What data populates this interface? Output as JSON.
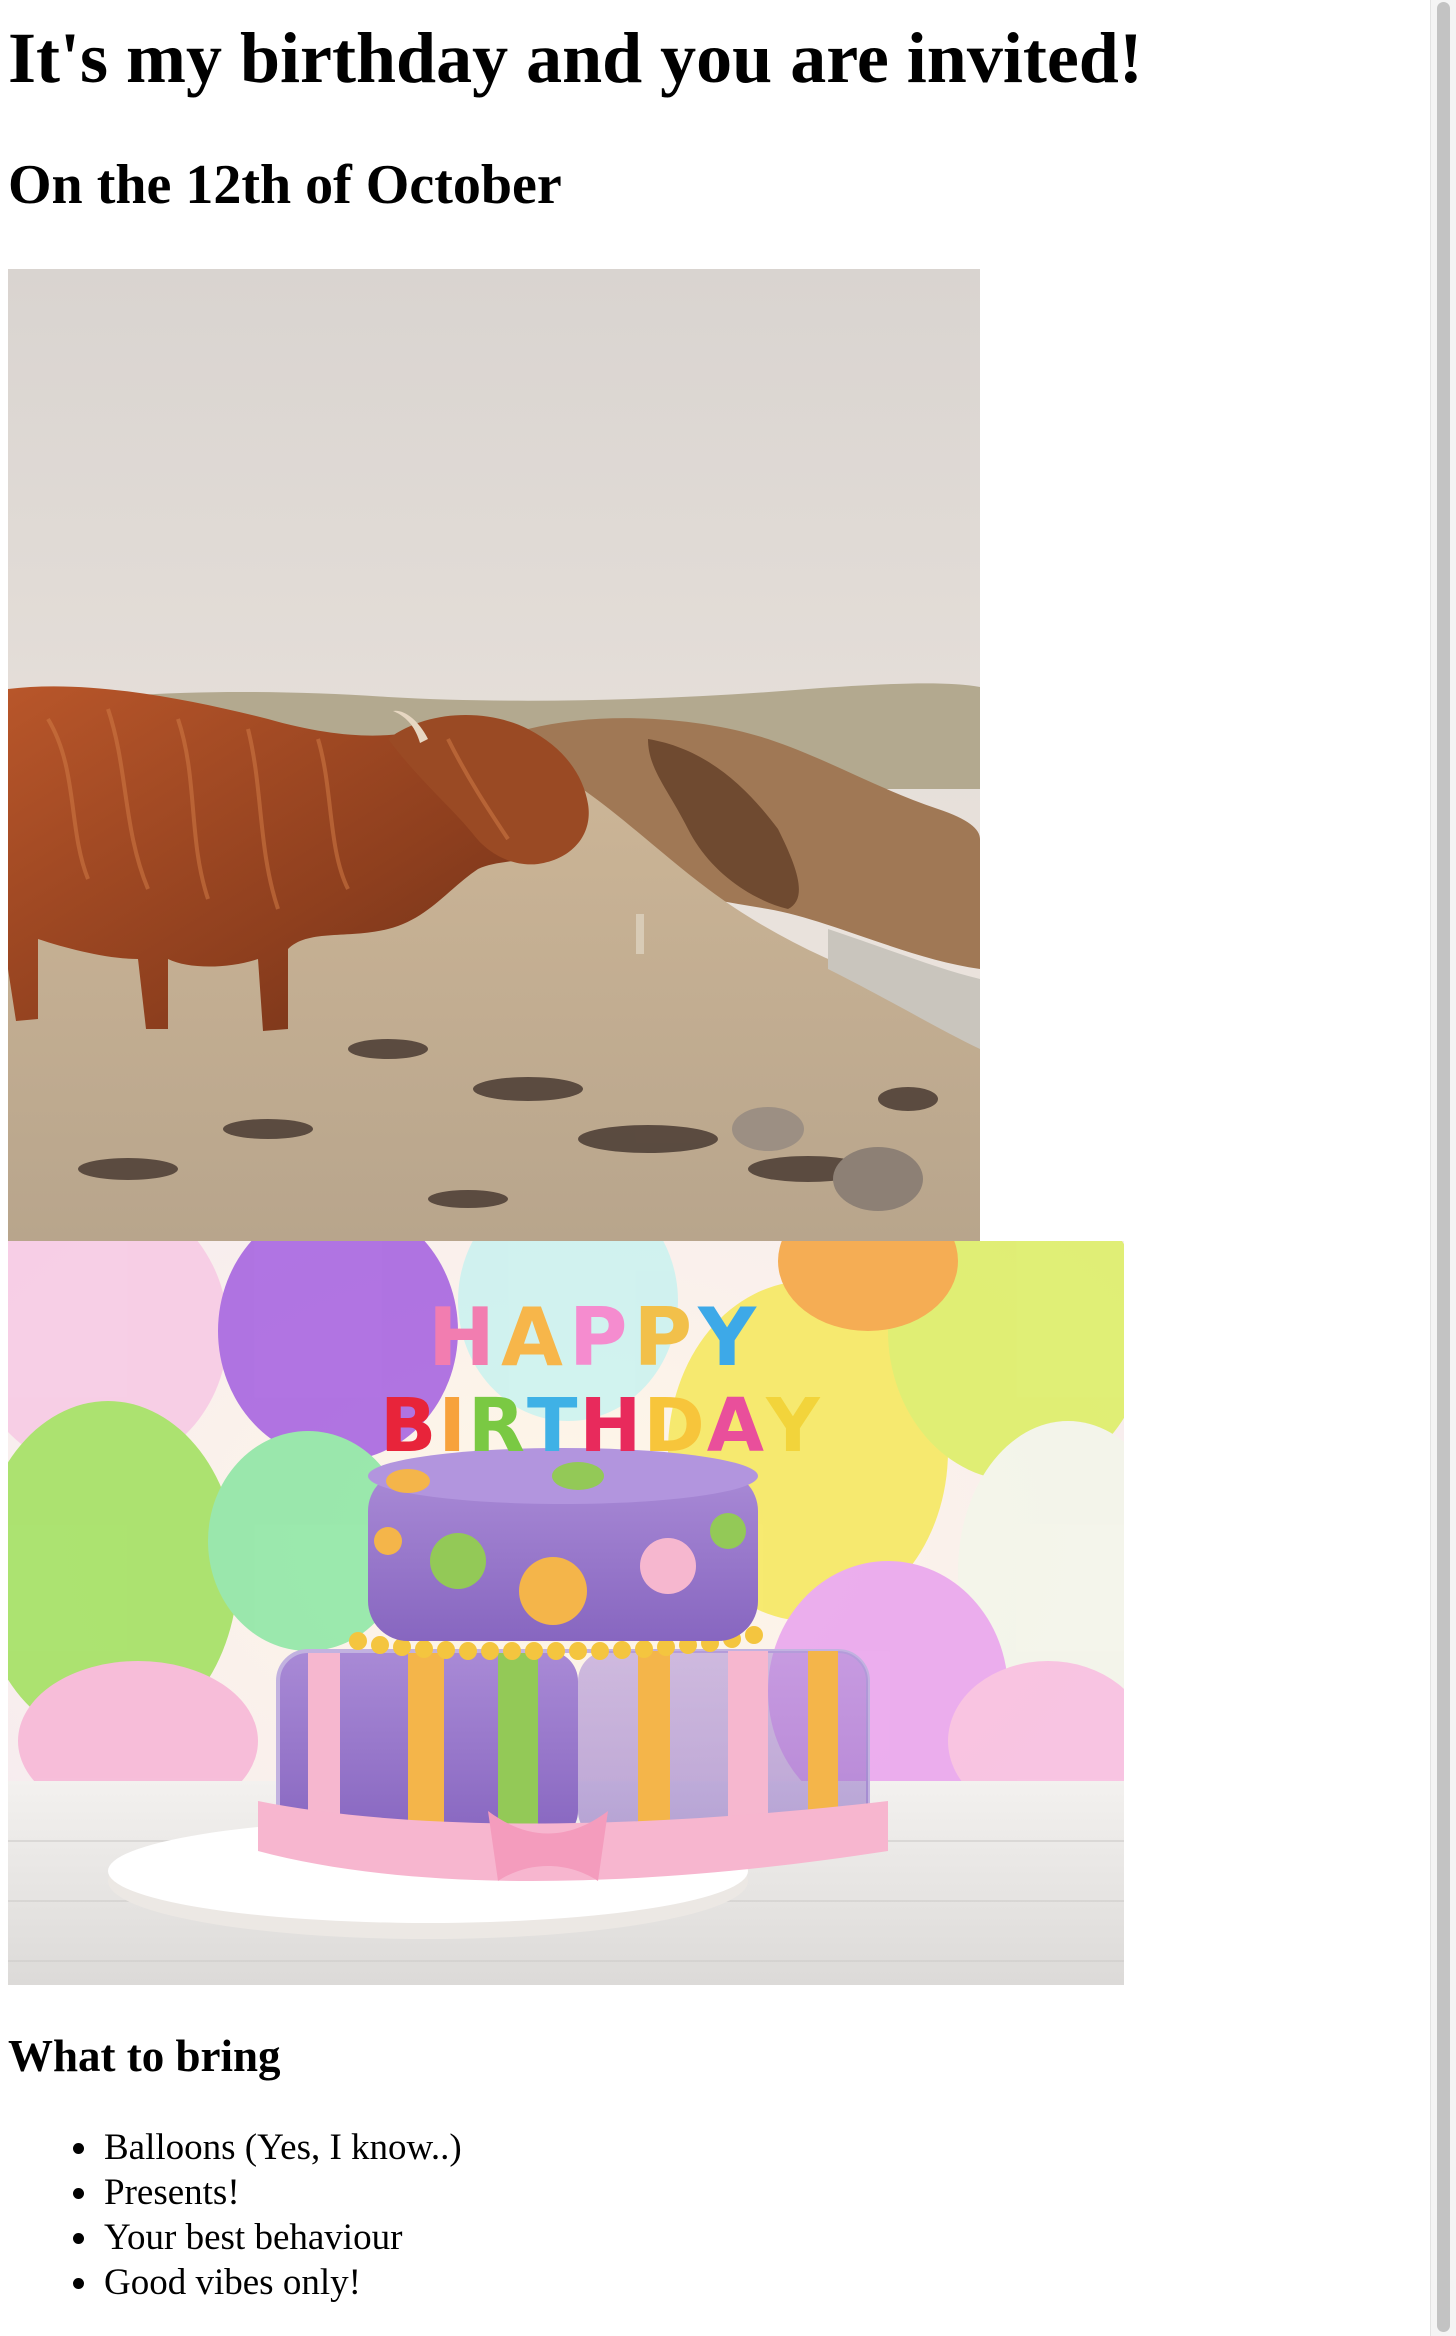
{
  "invitation": {
    "headline": "It's my birthday and you are invited!",
    "date_line": "On the 12th of October"
  },
  "images": {
    "highland_cow": {
      "subject": "highland-cow-photo"
    },
    "birthday_cake": {
      "subject": "birthday-cake-photo",
      "candle_letters_top": [
        "H",
        "A",
        "P",
        "P",
        "Y"
      ],
      "candle_letters_bottom": [
        "B",
        "I",
        "R",
        "T",
        "H",
        "D",
        "A",
        "Y"
      ],
      "candle_colors_top": [
        "#f27db0",
        "#f7b64a",
        "#f58ccf",
        "#f2c04a",
        "#3da9e8"
      ],
      "candle_colors_bottom": [
        "#e8243a",
        "#f7a23c",
        "#7ac943",
        "#3fb1e6",
        "#e82a5c",
        "#f7c53b",
        "#e94f9b",
        "#f2d43b"
      ]
    }
  },
  "bring_section": {
    "heading": "What to bring",
    "items": [
      "Balloons (Yes, I know..)",
      "Presents!",
      "Your best behaviour",
      "Good vibes only!"
    ]
  }
}
